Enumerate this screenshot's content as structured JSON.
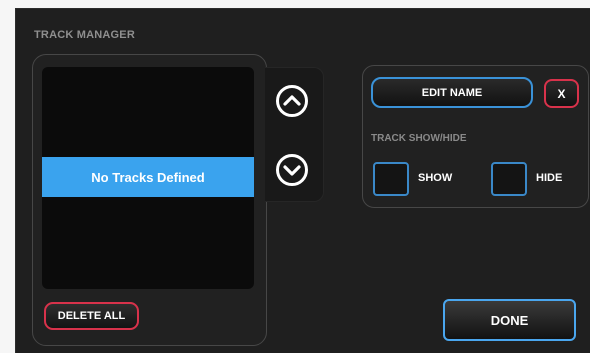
{
  "dialog": {
    "title": "TRACK MANAGER"
  },
  "track_list": {
    "rows": [
      "No Tracks Defined"
    ],
    "selected_color": "#3aa3ee"
  },
  "buttons": {
    "delete_all": "DELETE ALL",
    "edit_name": "EDIT NAME",
    "close": "X",
    "done": "DONE"
  },
  "icons": {
    "move_up": "chevron-up-circle-icon",
    "move_down": "chevron-down-circle-icon"
  },
  "visibility": {
    "label": "TRACK SHOW/HIDE",
    "show_label": "SHOW",
    "hide_label": "HIDE",
    "show_checked": false,
    "hide_checked": false
  },
  "colors": {
    "accent_blue": "#3a92d8",
    "accent_red": "#d8324b",
    "background": "#1f1f1f"
  }
}
